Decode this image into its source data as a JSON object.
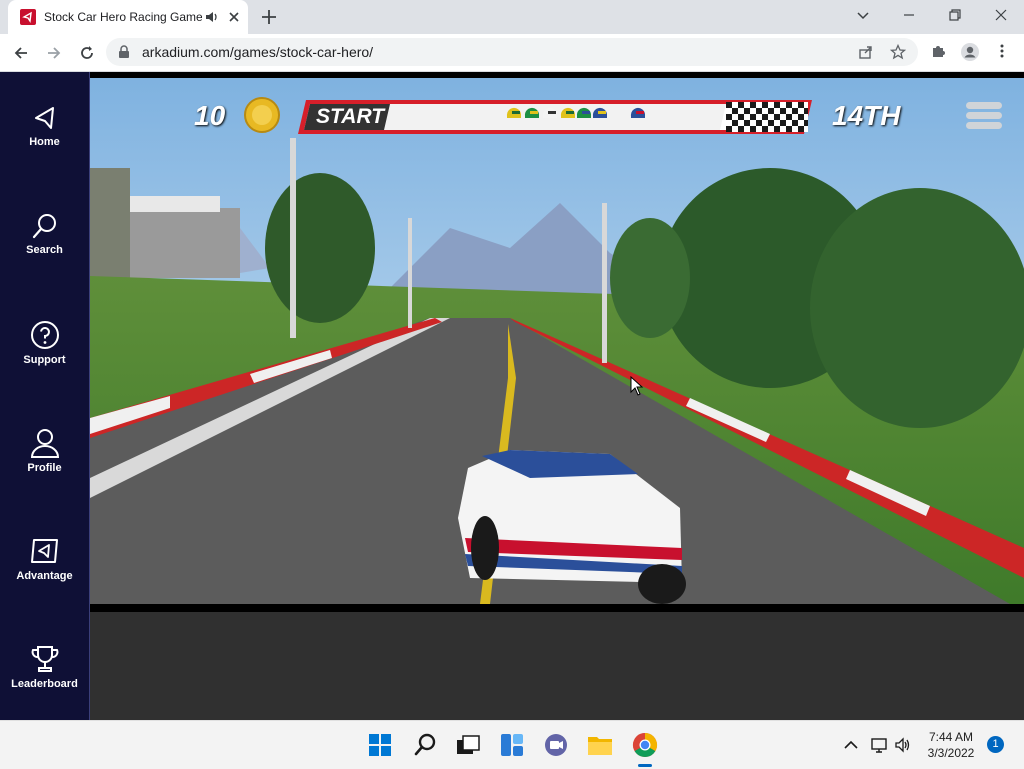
{
  "browser": {
    "tab_title": "Stock Car Hero Racing Game",
    "url": "arkadium.com/games/stock-car-hero/"
  },
  "sidebar": {
    "items": [
      {
        "label": "Home",
        "icon": "home-icon"
      },
      {
        "label": "Search",
        "icon": "search-icon"
      },
      {
        "label": "Support",
        "icon": "help-icon"
      },
      {
        "label": "Profile",
        "icon": "profile-icon"
      },
      {
        "label": "Advantage",
        "icon": "advantage-icon"
      },
      {
        "label": "Leaderboard",
        "icon": "trophy-icon"
      }
    ]
  },
  "game": {
    "coins": "10",
    "progress_start": "START",
    "position": "14TH"
  },
  "taskbar": {
    "time": "7:44 AM",
    "date": "3/3/2022",
    "notifications": "1"
  },
  "colors": {
    "sidebar_bg": "#0f1036",
    "arkadium_red": "#c8102e",
    "taskbar_accent": "#0067c0"
  }
}
